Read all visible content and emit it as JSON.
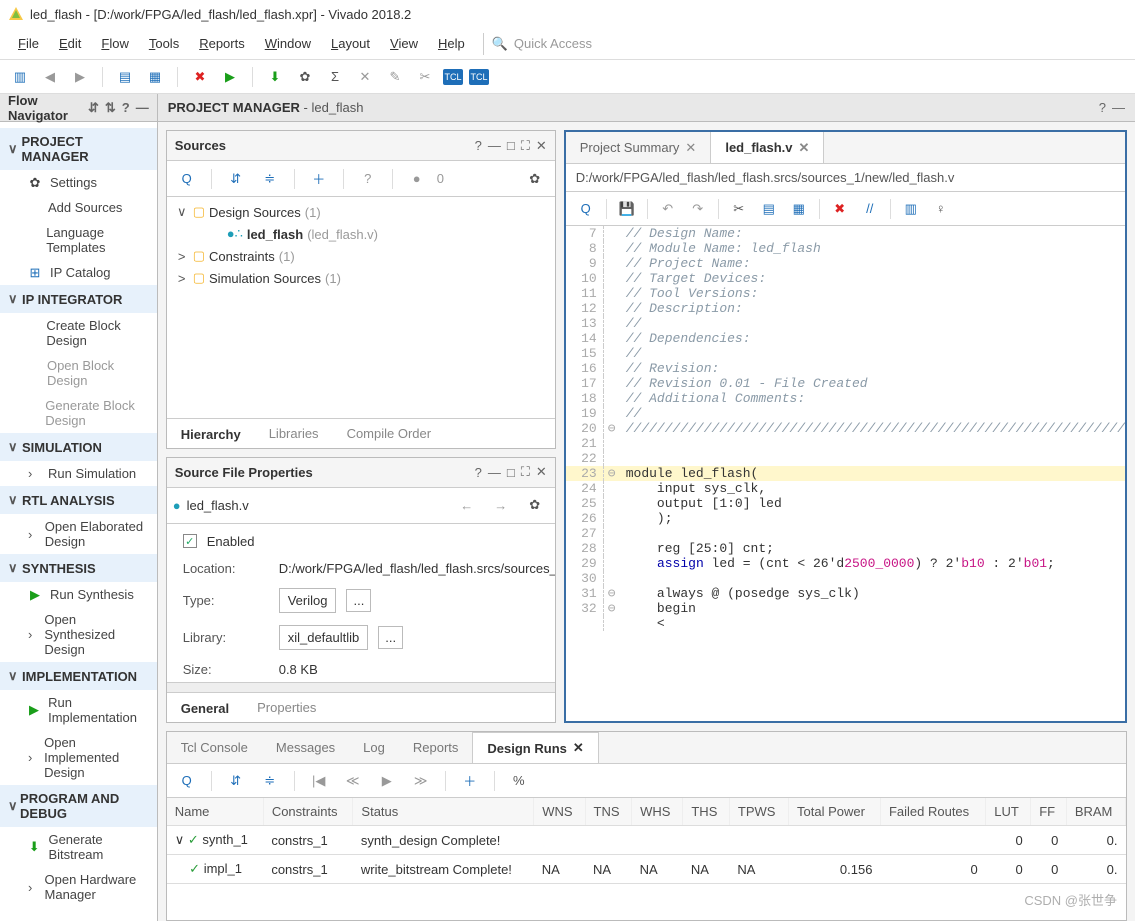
{
  "window": {
    "title": "led_flash - [D:/work/FPGA/led_flash/led_flash.xpr] - Vivado 2018.2"
  },
  "menus": [
    "File",
    "Edit",
    "Flow",
    "Tools",
    "Reports",
    "Window",
    "Layout",
    "View",
    "Help"
  ],
  "quick_access_placeholder": "Quick Access",
  "flow_nav": {
    "title": "Flow Navigator",
    "sections": [
      {
        "name": "PROJECT MANAGER",
        "items": [
          {
            "label": "Settings",
            "icon": "gear"
          },
          {
            "label": "Add Sources"
          },
          {
            "label": "Language Templates"
          },
          {
            "label": "IP Catalog",
            "icon": "ip"
          }
        ]
      },
      {
        "name": "IP INTEGRATOR",
        "items": [
          {
            "label": "Create Block Design"
          },
          {
            "label": "Open Block Design",
            "dim": true
          },
          {
            "label": "Generate Block Design",
            "dim": true
          }
        ]
      },
      {
        "name": "SIMULATION",
        "items": [
          {
            "label": "Run Simulation",
            "chev": true
          }
        ]
      },
      {
        "name": "RTL ANALYSIS",
        "items": [
          {
            "label": "Open Elaborated Design",
            "chev": true
          }
        ]
      },
      {
        "name": "SYNTHESIS",
        "items": [
          {
            "label": "Run Synthesis",
            "icon": "play"
          },
          {
            "label": "Open Synthesized Design",
            "chev": true
          }
        ]
      },
      {
        "name": "IMPLEMENTATION",
        "items": [
          {
            "label": "Run Implementation",
            "icon": "play"
          },
          {
            "label": "Open Implemented Design",
            "chev": true
          }
        ]
      },
      {
        "name": "PROGRAM AND DEBUG",
        "items": [
          {
            "label": "Generate Bitstream",
            "icon": "bitstream"
          },
          {
            "label": "Open Hardware Manager",
            "chev": true
          }
        ]
      }
    ]
  },
  "project_manager": {
    "title": "PROJECT MANAGER",
    "subtitle": "- led_flash"
  },
  "sources": {
    "title": "Sources",
    "badge_count": "0",
    "tabs": [
      "Hierarchy",
      "Libraries",
      "Compile Order"
    ],
    "active_tab": 0,
    "tree": [
      {
        "ind": 0,
        "chev": "∨",
        "icon": "folder",
        "label": "Design Sources",
        "suffix": "(1)"
      },
      {
        "ind": 2,
        "chev": "",
        "icon": "dot-teal",
        "label": "led_flash",
        "suffix": "(led_flash.v)"
      },
      {
        "ind": 0,
        "chev": ">",
        "icon": "folder",
        "label": "Constraints",
        "suffix": "(1)"
      },
      {
        "ind": 0,
        "chev": ">",
        "icon": "folder",
        "label": "Simulation Sources",
        "suffix": "(1)"
      }
    ]
  },
  "sfp": {
    "title": "Source File Properties",
    "file": "led_flash.v",
    "enabled": "Enabled",
    "rows": {
      "location_lbl": "Location:",
      "location_val": "D:/work/FPGA/led_flash/led_flash.srcs/sources_",
      "type_lbl": "Type:",
      "type_val": "Verilog",
      "lib_lbl": "Library:",
      "lib_val": "xil_defaultlib",
      "size_lbl": "Size:",
      "size_val": "0.8 KB"
    },
    "tabs": [
      "General",
      "Properties"
    ],
    "active_tab": 0
  },
  "editor": {
    "tabs": [
      {
        "label": "Project Summary",
        "close": true
      },
      {
        "label": "led_flash.v",
        "close": true
      }
    ],
    "active_tab": 1,
    "path": "D:/work/FPGA/led_flash/led_flash.srcs/sources_1/new/led_flash.v",
    "code": [
      {
        "n": 7,
        "t": "// Design Name: ",
        "cls": "cm"
      },
      {
        "n": 8,
        "t": "// Module Name: led_flash",
        "cls": "cm"
      },
      {
        "n": 9,
        "t": "// Project Name: ",
        "cls": "cm"
      },
      {
        "n": 10,
        "t": "// Target Devices: ",
        "cls": "cm"
      },
      {
        "n": 11,
        "t": "// Tool Versions: ",
        "cls": "cm"
      },
      {
        "n": 12,
        "t": "// Description: ",
        "cls": "cm"
      },
      {
        "n": 13,
        "t": "// ",
        "cls": "cm"
      },
      {
        "n": 14,
        "t": "// Dependencies: ",
        "cls": "cm"
      },
      {
        "n": 15,
        "t": "// ",
        "cls": "cm"
      },
      {
        "n": 16,
        "t": "// Revision:",
        "cls": "cm"
      },
      {
        "n": 17,
        "t": "// Revision 0.01 - File Created",
        "cls": "cm"
      },
      {
        "n": 18,
        "t": "// Additional Comments:",
        "cls": "cm"
      },
      {
        "n": 19,
        "t": "// ",
        "cls": "cm"
      },
      {
        "n": 20,
        "t": "////////////////////////////////////////////////////////////////",
        "cls": "cm",
        "fold": "⊖"
      },
      {
        "n": 21,
        "t": "",
        "cls": ""
      },
      {
        "n": 22,
        "t": "",
        "cls": ""
      },
      {
        "n": 23,
        "t": "module led_flash(",
        "cls": "",
        "hl": true,
        "fold": "⊖"
      },
      {
        "n": 24,
        "t": "    input sys_clk,",
        "cls": ""
      },
      {
        "n": 25,
        "t": "    output [1:0] led",
        "cls": ""
      },
      {
        "n": 26,
        "t": "    );",
        "cls": ""
      },
      {
        "n": 27,
        "t": "",
        "cls": ""
      },
      {
        "n": 28,
        "t": "    reg [25:0] cnt;",
        "cls": ""
      },
      {
        "n": 29,
        "t": "    assign led = (cnt < 26'd2500_0000) ? 2'b10 : 2'b01;",
        "cls": "",
        "colorize": true
      },
      {
        "n": 30,
        "t": "",
        "cls": ""
      },
      {
        "n": 31,
        "t": "    always @ (posedge sys_clk)",
        "cls": "",
        "fold": "⊖"
      },
      {
        "n": 32,
        "t": "    begin",
        "cls": "",
        "fold": "⊖"
      }
    ]
  },
  "bottom": {
    "tabs": [
      "Tcl Console",
      "Messages",
      "Log",
      "Reports",
      "Design Runs"
    ],
    "active_tab": 4,
    "columns": [
      "Name",
      "Constraints",
      "Status",
      "WNS",
      "TNS",
      "WHS",
      "THS",
      "TPWS",
      "Total Power",
      "Failed Routes",
      "LUT",
      "FF",
      "BRAM"
    ],
    "rows": [
      {
        "expand": true,
        "name": "synth_1",
        "constraints": "constrs_1",
        "status": "synth_design Complete!",
        "wns": "",
        "tns": "",
        "whs": "",
        "ths": "",
        "tpws": "",
        "tp": "",
        "fr": "",
        "lut": "0",
        "ff": "0",
        "bram": "0."
      },
      {
        "expand": false,
        "name": "impl_1",
        "constraints": "constrs_1",
        "status": "write_bitstream Complete!",
        "wns": "NA",
        "tns": "NA",
        "whs": "NA",
        "ths": "NA",
        "tpws": "NA",
        "tp": "0.156",
        "fr": "0",
        "lut": "0",
        "ff": "0",
        "bram": "0."
      }
    ]
  },
  "watermark": "CSDN @张世争"
}
